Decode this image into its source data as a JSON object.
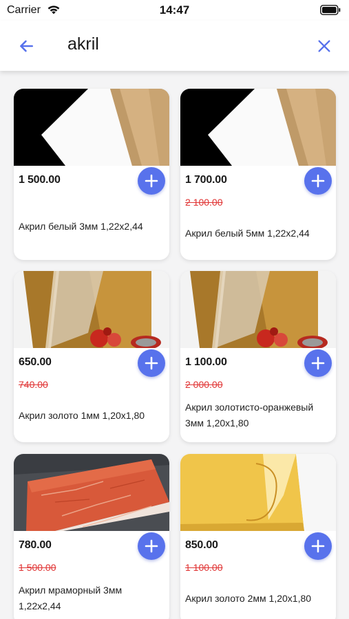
{
  "status_bar": {
    "carrier": "Carrier",
    "time": "14:47"
  },
  "search": {
    "query": "akril"
  },
  "icons": {
    "back": "arrow-left-icon",
    "clear": "close-icon",
    "add": "plus-icon"
  },
  "colors": {
    "accent": "#5872ec",
    "old_price": "#e03333",
    "background": "#f4f4f5"
  },
  "products": [
    {
      "price": "1 500.00",
      "old_price": "",
      "title": "Акрил белый 3мм 1,22x2,44",
      "image": "white-acrylic-sheet"
    },
    {
      "price": "1 700.00",
      "old_price": "2 100.00",
      "title": "Акрил белый 5мм 1,22x2,44",
      "image": "white-acrylic-sheet"
    },
    {
      "price": "650.00",
      "old_price": "740.00",
      "title": "Акрил золото 1мм 1,20x1,80",
      "image": "gold-acrylic-sheet"
    },
    {
      "price": "1 100.00",
      "old_price": "2 000.00",
      "title": "Акрил золотисто-оранжевый 3мм 1,20x1,80",
      "image": "gold-acrylic-sheet"
    },
    {
      "price": "780.00",
      "old_price": "1 500.00",
      "title": "Акрил мраморный 3мм 1,22x2,44",
      "image": "marble-acrylic-sheet"
    },
    {
      "price": "850.00",
      "old_price": "1 100.00",
      "title": "Акрил золото 2мм 1,20x1,80",
      "image": "yellow-acrylic-sheet"
    }
  ]
}
